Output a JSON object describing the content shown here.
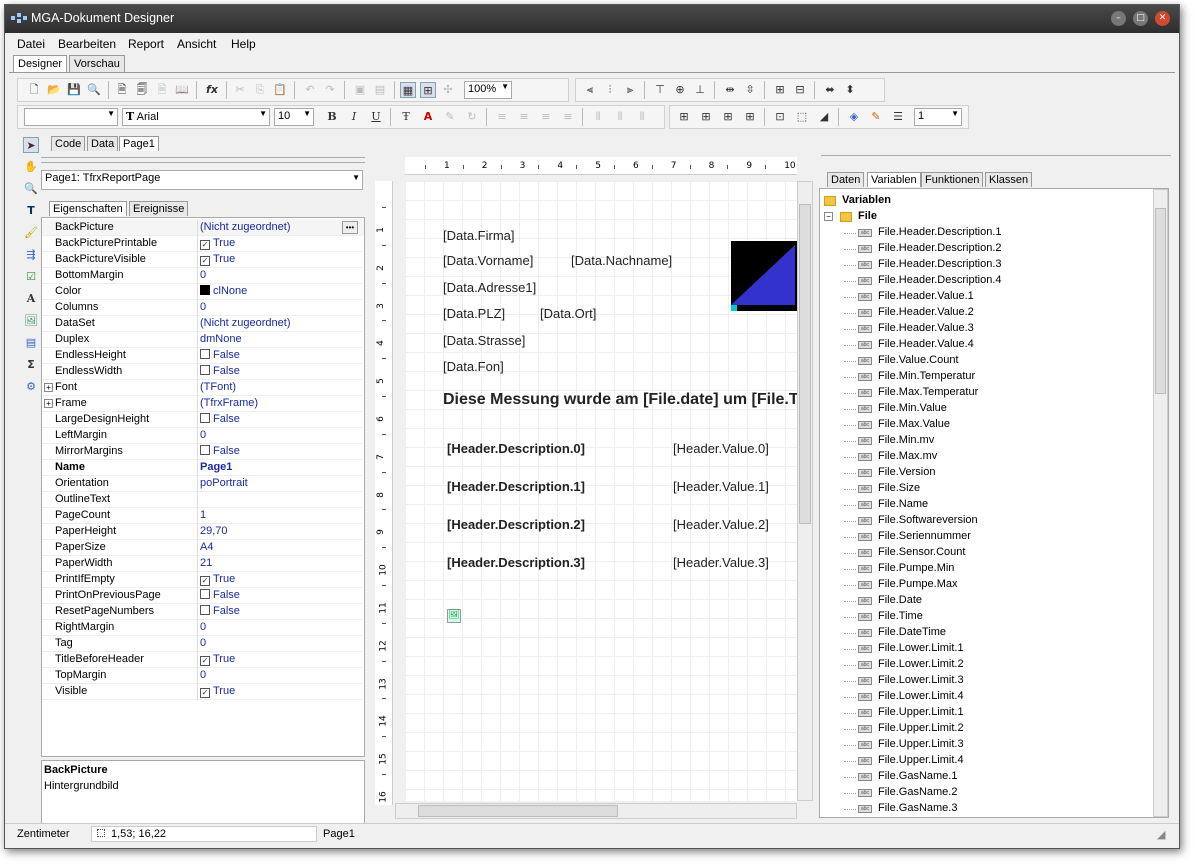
{
  "window": {
    "title": "MGA-Dokument Designer"
  },
  "menu": [
    "Datei",
    "Bearbeiten",
    "Report",
    "Ansicht",
    "Help"
  ],
  "main_tabs": [
    "Designer",
    "Vorschau"
  ],
  "toolbar": {
    "zoom": "100%",
    "font_name": "Arial",
    "font_size": "10",
    "line_width": "1"
  },
  "page_tabs": [
    "Code",
    "Data",
    "Page1"
  ],
  "inspector": {
    "object": "Page1: TfrxReportPage",
    "tabs": [
      "Eigenschaften",
      "Ereignisse"
    ],
    "rows": [
      {
        "n": "BackPicture",
        "v": "(Nicht zugeordnet)",
        "btn": true
      },
      {
        "n": "BackPicturePrintable",
        "v": "True",
        "chk": true
      },
      {
        "n": "BackPictureVisible",
        "v": "True",
        "chk": true
      },
      {
        "n": "BottomMargin",
        "v": "0"
      },
      {
        "n": "Color",
        "v": "clNone",
        "color": true
      },
      {
        "n": "Columns",
        "v": "0"
      },
      {
        "n": "DataSet",
        "v": "(Nicht zugeordnet)"
      },
      {
        "n": "Duplex",
        "v": "dmNone"
      },
      {
        "n": "EndlessHeight",
        "v": "False",
        "chk": false
      },
      {
        "n": "EndlessWidth",
        "v": "False",
        "chk": false
      },
      {
        "n": "Font",
        "v": "(TFont)",
        "exp": true
      },
      {
        "n": "Frame",
        "v": "(TfrxFrame)",
        "exp": true
      },
      {
        "n": "LargeDesignHeight",
        "v": "False",
        "chk": false
      },
      {
        "n": "LeftMargin",
        "v": "0"
      },
      {
        "n": "MirrorMargins",
        "v": "False",
        "chk": false
      },
      {
        "n": "Name",
        "v": "Page1",
        "bold": true
      },
      {
        "n": "Orientation",
        "v": "poPortrait"
      },
      {
        "n": "OutlineText",
        "v": ""
      },
      {
        "n": "PageCount",
        "v": "1"
      },
      {
        "n": "PaperHeight",
        "v": "29,70"
      },
      {
        "n": "PaperSize",
        "v": "A4"
      },
      {
        "n": "PaperWidth",
        "v": "21"
      },
      {
        "n": "PrintIfEmpty",
        "v": "True",
        "chk": true
      },
      {
        "n": "PrintOnPreviousPage",
        "v": "False",
        "chk": false
      },
      {
        "n": "ResetPageNumbers",
        "v": "False",
        "chk": false
      },
      {
        "n": "RightMargin",
        "v": "0"
      },
      {
        "n": "Tag",
        "v": "0"
      },
      {
        "n": "TitleBeforeHeader",
        "v": "True",
        "chk": true
      },
      {
        "n": "TopMargin",
        "v": "0"
      },
      {
        "n": "Visible",
        "v": "True",
        "chk": true
      }
    ],
    "help_title": "BackPicture",
    "help_text": "Hintergrundbild"
  },
  "ruler": {
    "h": [
      "1",
      "2",
      "3",
      "4",
      "5",
      "6",
      "7",
      "8",
      "9",
      "10"
    ],
    "v": [
      "1",
      "2",
      "3",
      "4",
      "5",
      "6",
      "7",
      "8",
      "9",
      "10",
      "11",
      "12",
      "13",
      "14",
      "15",
      "16"
    ]
  },
  "design": {
    "fields": [
      "[Data.Firma]",
      "[Data.Vorname]",
      "[Data.Nachname]",
      "[Data.Adresse1]",
      "[Data.PLZ]",
      "[Data.Ort]",
      "[Data.Strasse]",
      "[Data.Fon]"
    ],
    "headline": "Diese Messung wurde am [File.date] um [File.T",
    "desc": [
      "[Header.Description.0]",
      "[Header.Description.1]",
      "[Header.Description.2]",
      "[Header.Description.3]"
    ],
    "vals": [
      "[Header.Value.0]",
      "[Header.Value.1]",
      "[Header.Value.2]",
      "[Header.Value.3]"
    ]
  },
  "right_tabs": [
    "Daten",
    "Variablen",
    "Funktionen",
    "Klassen"
  ],
  "tree": {
    "root": "Variablen",
    "folder": "File",
    "items": [
      "File.Header.Description.1",
      "File.Header.Description.2",
      "File.Header.Description.3",
      "File.Header.Description.4",
      "File.Header.Value.1",
      "File.Header.Value.2",
      "File.Header.Value.3",
      "File.Header.Value.4",
      "File.Value.Count",
      "File.Min.Temperatur",
      "File.Max.Temperatur",
      "File.Min.Value",
      "File.Max.Value",
      "File.Min.mv",
      "File.Max.mv",
      "File.Version",
      "File.Size",
      "File.Name",
      "File.Softwareversion",
      "File.Seriennummer",
      "File.Sensor.Count",
      "File.Pumpe.Min",
      "File.Pumpe.Max",
      "File.Date",
      "File.Time",
      "File.DateTime",
      "File.Lower.Limit.1",
      "File.Lower.Limit.2",
      "File.Lower.Limit.3",
      "File.Lower.Limit.4",
      "File.Upper.Limit.1",
      "File.Upper.Limit.2",
      "File.Upper.Limit.3",
      "File.Upper.Limit.4",
      "File.GasName.1",
      "File.GasName.2",
      "File.GasName.3"
    ]
  },
  "status": {
    "unit": "Zentimeter",
    "coords": "1,53; 16,22",
    "page": "Page1"
  }
}
